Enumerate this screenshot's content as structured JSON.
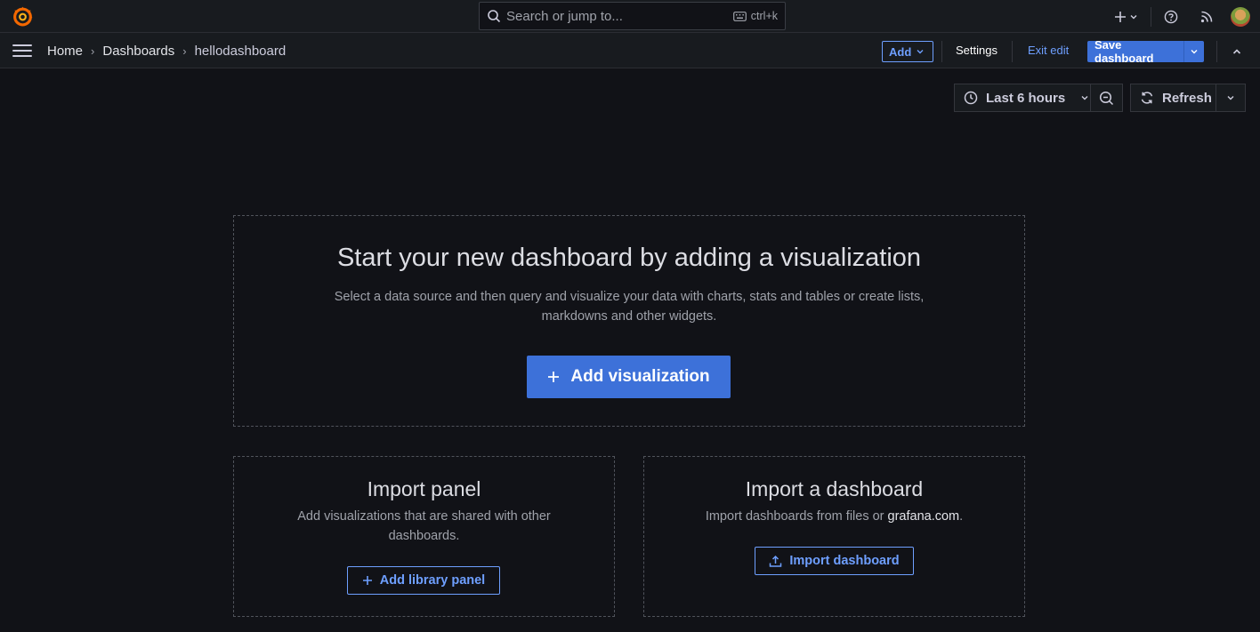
{
  "topbar": {
    "search_placeholder": "Search or jump to...",
    "search_shortcut": "ctrl+k"
  },
  "nav": {
    "breadcrumbs": [
      "Home",
      "Dashboards",
      "hellodashboard"
    ],
    "add_label": "Add",
    "settings_label": "Settings",
    "exit_edit_label": "Exit edit",
    "save_label": "Save dashboard"
  },
  "toolbar": {
    "time_range": "Last 6 hours",
    "refresh_label": "Refresh"
  },
  "empty_state": {
    "title": "Start your new dashboard by adding a visualization",
    "description_line1": "Select a data source and then query and visualize your data with charts, stats and tables or create lists,",
    "description_line2": "markdowns and other widgets.",
    "button_label": "Add visualization"
  },
  "import_panel": {
    "title": "Import panel",
    "description_line1": "Add visualizations that are shared with other",
    "description_line2": "dashboards.",
    "button_label": "Add library panel"
  },
  "import_dashboard": {
    "title": "Import a dashboard",
    "description_prefix": "Import dashboards from files or ",
    "description_link": "grafana.com",
    "description_suffix": ".",
    "button_label": "Import dashboard"
  },
  "colors": {
    "background": "#111217",
    "surface": "#181b1f",
    "primary": "#3d71d9",
    "link": "#6e9fff",
    "logo": "#f46800"
  },
  "icons": [
    "grafana-logo-icon",
    "search-icon",
    "keyboard-icon",
    "plus-icon",
    "chevron-down-icon",
    "help-icon",
    "rss-icon",
    "menu-icon",
    "chevron-right-icon",
    "chevron-up-icon",
    "clock-icon",
    "zoom-out-icon",
    "refresh-icon",
    "upload-icon"
  ]
}
